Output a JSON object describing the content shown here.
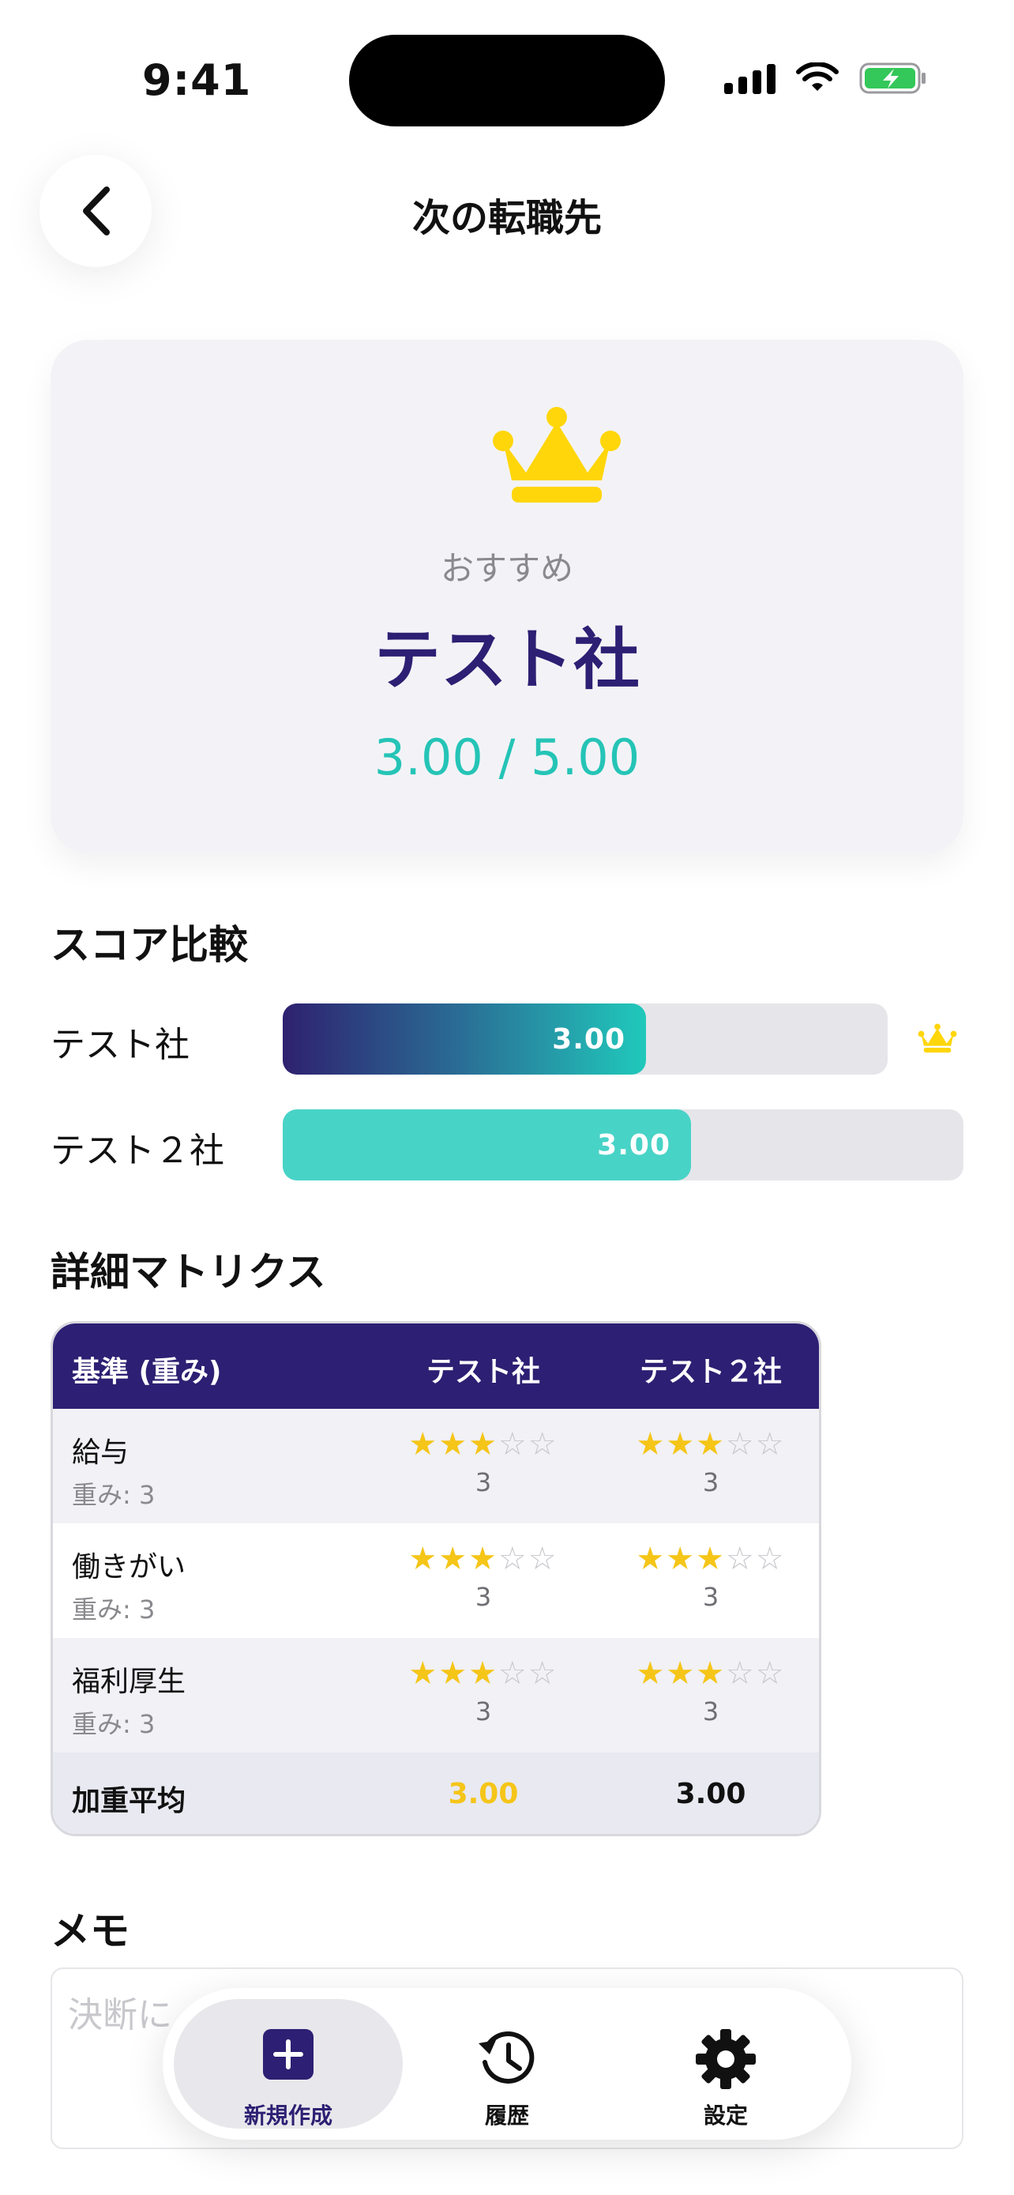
{
  "status": {
    "time": "9:41"
  },
  "header": {
    "title": "次の転職先"
  },
  "recommendation": {
    "label": "おすすめ",
    "company": "テスト社",
    "score": "3.00 / 5.00",
    "icon": "crown-icon"
  },
  "score_compare": {
    "title": "スコア比較",
    "rows": [
      {
        "name": "テスト社",
        "value": "3.00",
        "fraction": 0.6,
        "crown": true
      },
      {
        "name": "テスト２社",
        "value": "3.00",
        "fraction": 0.6,
        "crown": false
      }
    ]
  },
  "matrix": {
    "title": "詳細マトリクス",
    "headers": [
      "基準 (重み)",
      "テスト社",
      "テスト２社"
    ],
    "rows": [
      {
        "criterion": "給与",
        "weight": "重み: 3",
        "ratings": [
          3,
          3
        ],
        "values": [
          "3",
          "3"
        ]
      },
      {
        "criterion": "働きがい",
        "weight": "重み: 3",
        "ratings": [
          3,
          3
        ],
        "values": [
          "3",
          "3"
        ]
      },
      {
        "criterion": "福利厚生",
        "weight": "重み: 3",
        "ratings": [
          3,
          3
        ],
        "values": [
          "3",
          "3"
        ]
      }
    ],
    "footer": {
      "label": "加重平均",
      "values": [
        "3.00",
        "3.00"
      ]
    }
  },
  "memo": {
    "title": "メモ",
    "placeholder": "決断に"
  },
  "tabbar": {
    "items": [
      {
        "label": "新規作成",
        "icon": "plus-square-icon",
        "active": true
      },
      {
        "label": "履歴",
        "icon": "history-icon",
        "active": false
      },
      {
        "label": "設定",
        "icon": "gear-icon",
        "active": false
      }
    ]
  },
  "colors": {
    "primary": "#2d1f73",
    "teal": "#25c4b6",
    "star": "#f5c518",
    "crown": "#ffd60a"
  }
}
